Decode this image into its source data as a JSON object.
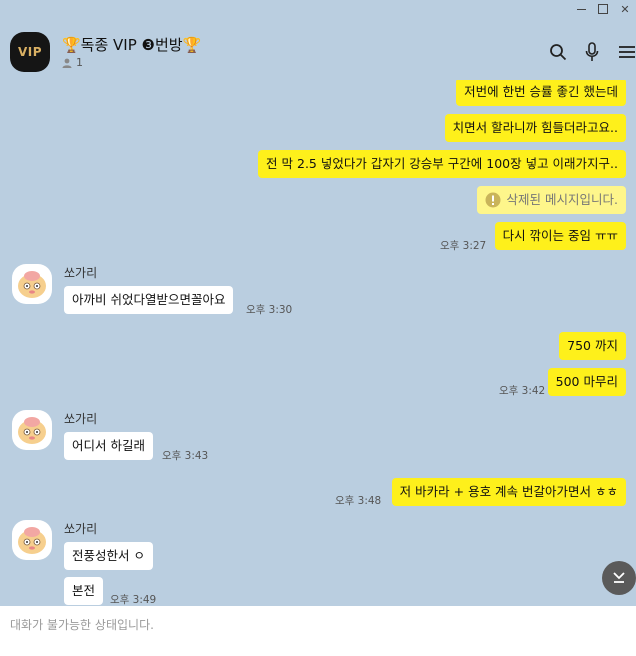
{
  "window": {
    "controls": [
      "minimize",
      "maximize",
      "close"
    ]
  },
  "header": {
    "avatar_text": "VIP",
    "title": "🏆독종 VIP ❸번방🏆",
    "member_count": "1",
    "icons": [
      "search-icon",
      "mic-icon",
      "menu-icon"
    ]
  },
  "messages": {
    "m1": "저번에 한번 승률 좋긴 했는데",
    "m2": "치면서 할라니까 힘들더라고요..",
    "m3": "전 막 2.5 넣었다가 갑자기 강승부 구간에 100장 넣고 이래가지구..",
    "m4": "삭제된 메시지입니다.",
    "m5": "다시 깎이는 중임 ㅠㅠ",
    "t5": "오후 3:27",
    "s1": "쏘가리",
    "m6": "아까비 쉬었다열받으면꼴아요",
    "t6": "오후 3:30",
    "m7": "750 까지",
    "m8": "500 마무리",
    "t8": "오후 3:42",
    "s2": "쏘가리",
    "m9": "어디서 하길래",
    "t9": "오후 3:43",
    "m10": "저 바카라 + 용호 계속 번갈아가면서 ㅎㅎ",
    "t10": "오후 3:48",
    "s3": "쏘가리",
    "m11": "전풍성한서 ㅇ",
    "m12": "본전",
    "t12": "오후 3:49"
  },
  "footer": {
    "status": "대화가 불가능한 상태입니다."
  },
  "colors": {
    "background": "#bacee0",
    "my_bubble": "#fef01b",
    "their_bubble": "#ffffff",
    "footer": "#ffffff"
  }
}
